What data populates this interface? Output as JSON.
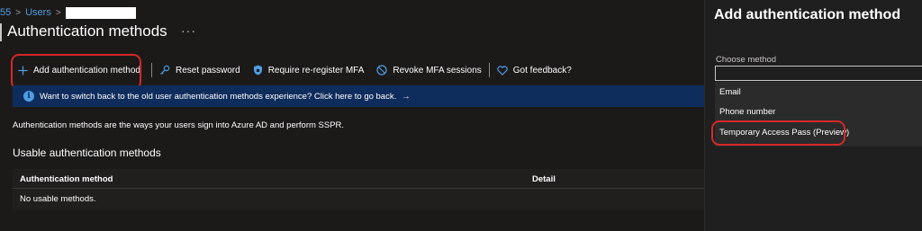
{
  "breadcrumb": {
    "items": [
      "55",
      "Users"
    ]
  },
  "page": {
    "title": "Authentication methods",
    "more_label": "···"
  },
  "toolbar": {
    "add_method": "Add authentication method",
    "reset_password": "Reset password",
    "require_reregister": "Require re-register MFA",
    "revoke_sessions": "Revoke MFA sessions",
    "feedback": "Got feedback?"
  },
  "banner": {
    "text": "Want to switch back to the old user authentication methods experience? Click here to go back.",
    "arrow": "→"
  },
  "description": "Authentication methods are the ways your users sign into Azure AD and perform SSPR.",
  "usable": {
    "heading": "Usable authentication methods",
    "columns": [
      "Authentication method",
      "Detail"
    ],
    "empty": "No usable methods."
  },
  "panel": {
    "title": "Add authentication method",
    "choose_label": "Choose method",
    "input_value": "",
    "options": [
      "Email",
      "Phone number",
      "Temporary Access Pass (Preview)"
    ]
  },
  "colors": {
    "accent": "#4f9de3",
    "banner_bg": "#0f2d5c",
    "highlight_oval": "#d62828",
    "background": "#1b1a19"
  }
}
